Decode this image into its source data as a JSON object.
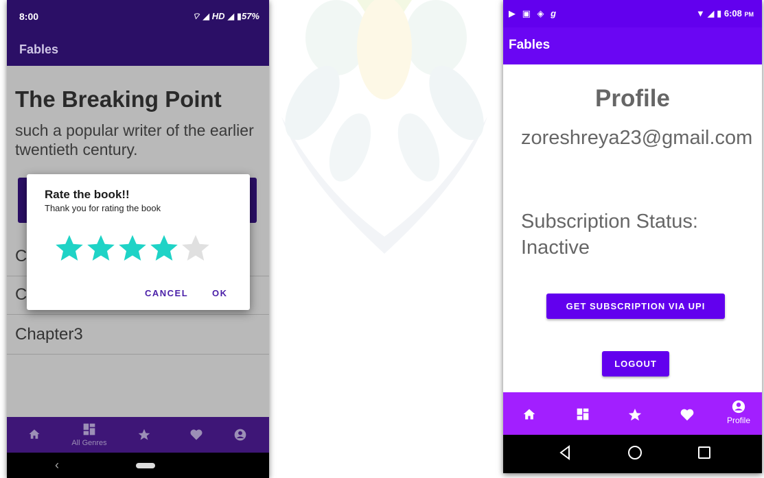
{
  "left_phone": {
    "status": {
      "time": "8:00",
      "indicators": "HD",
      "battery": "57%"
    },
    "app_title": "Fables",
    "book_title": "The Breaking Point",
    "description": "such a popular writer of the earlier twentieth century.",
    "chapters": [
      {
        "label": "C"
      },
      {
        "label": "C"
      },
      {
        "label": "Chapter3"
      }
    ],
    "dialog": {
      "title": "Rate the book!!",
      "message": "Thank you for rating the book",
      "rating": 4,
      "max_rating": 5,
      "cancel_label": "CANCEL",
      "ok_label": "OK"
    },
    "bottom_nav": [
      {
        "icon": "home-icon",
        "label": ""
      },
      {
        "icon": "grid-icon",
        "label": "All Genres"
      },
      {
        "icon": "star-icon",
        "label": ""
      },
      {
        "icon": "heart-icon",
        "label": ""
      },
      {
        "icon": "profile-icon",
        "label": ""
      }
    ],
    "colors": {
      "primary": "#2b0f66",
      "star_filled": "#1fd3c6",
      "star_empty": "#e0e0e0"
    }
  },
  "right_phone": {
    "status": {
      "time": "6:08",
      "time_suffix": "PM",
      "notification_glyph": "g"
    },
    "app_title": "Fables",
    "heading": "Profile",
    "email": "zoreshreya23@gmail.com",
    "subscription_label": "Subscription Status:",
    "subscription_value": "Inactive",
    "subscribe_button": "GET SUBSCRIPTION VIA UPI",
    "logout_button": "LOGOUT",
    "bottom_nav": [
      {
        "icon": "home-icon",
        "label": ""
      },
      {
        "icon": "grid-icon",
        "label": ""
      },
      {
        "icon": "star-icon",
        "label": ""
      },
      {
        "icon": "heart-icon",
        "label": ""
      },
      {
        "icon": "profile-icon",
        "label": "Profile",
        "active": true
      }
    ],
    "colors": {
      "primary": "#6200ee",
      "nav": "#a21fff"
    }
  }
}
